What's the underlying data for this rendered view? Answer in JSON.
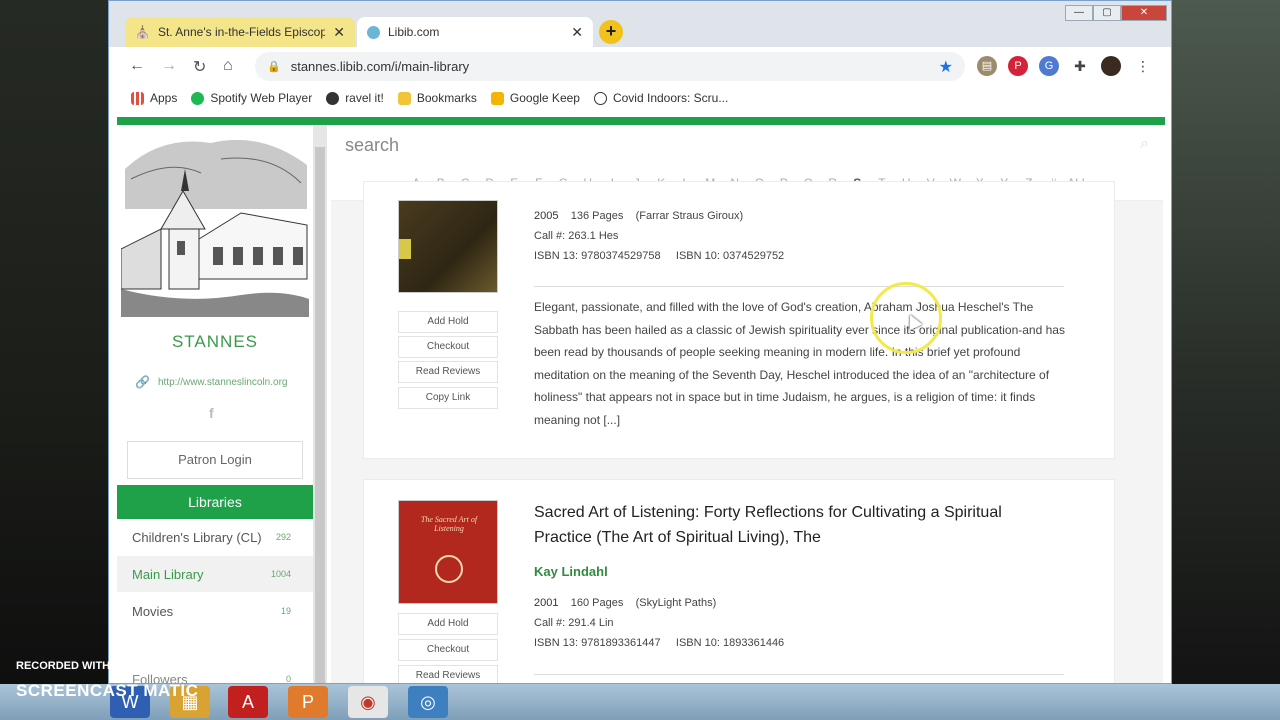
{
  "browser": {
    "tabs": [
      {
        "label": "St. Anne's in-the-Fields Episcopa",
        "close": "✕"
      },
      {
        "label": "Libib.com",
        "close": "✕"
      }
    ],
    "new_tab": "+",
    "url": "stannes.libib.com/i/main-library",
    "bookmarks": [
      "Apps",
      "Spotify Web Player",
      "ravel it!",
      "Bookmarks",
      "Google Keep",
      "Covid Indoors: Scru..."
    ]
  },
  "sidebar": {
    "library_name": "STANNES",
    "website": "http://www.stanneslincoln.org",
    "facebook": "f",
    "patron_login": "Patron Login",
    "libraries_heading": "Libraries",
    "libraries": [
      {
        "name": "Children's Library (CL)",
        "count": "292"
      },
      {
        "name": "Main Library",
        "count": "1004"
      },
      {
        "name": "Movies",
        "count": "19"
      },
      {
        "name": "Followers",
        "count": "0"
      }
    ]
  },
  "main": {
    "search_placeholder": "search",
    "alphabet": [
      "A",
      "B",
      "C",
      "D",
      "E",
      "F",
      "G",
      "H",
      "I",
      "J",
      "K",
      "L",
      "M",
      "N",
      "O",
      "P",
      "Q",
      "R",
      "S",
      "T",
      "U",
      "V",
      "W",
      "X",
      "Y",
      "Z",
      "#",
      "ALL"
    ],
    "current_letter": "S",
    "item1": {
      "year": "2005",
      "pages": "136 Pages",
      "publisher": "(Farrar Straus Giroux)",
      "call_label": "Call #:",
      "call": "263.1 Hes",
      "isbn13_label": "ISBN 13:",
      "isbn13": "9780374529758",
      "isbn10_label": "ISBN 10:",
      "isbn10": "0374529752",
      "buttons": [
        "Add Hold",
        "Checkout",
        "Read Reviews",
        "Copy Link"
      ],
      "description": "Elegant, passionate, and filled with the love of God's creation, Abraham Joshua Heschel's The Sabbath has been hailed as a classic of Jewish spirituality ever since its original publication-and has been read by thousands of people seeking meaning in modern life. In this brief yet profound meditation on the meaning of the Seventh Day, Heschel introduced the idea of an \"architecture of holiness\" that appears not in space but in time Judaism, he argues, is a religion of time: it finds meaning not [...]"
    },
    "item2": {
      "title": "Sacred Art of Listening: Forty Reflections for Cultivating a Spiritual Practice (The Art of Spiritual Living), The",
      "author": "Kay Lindahl",
      "year": "2001",
      "pages": "160 Pages",
      "publisher": "(SkyLight Paths)",
      "call_label": "Call #:",
      "call": "291.4 Lin",
      "isbn13_label": "ISBN 13:",
      "isbn13": "9781893361447",
      "isbn10_label": "ISBN 10:",
      "isbn10": "1893361446",
      "buttons": [
        "Add Hold",
        "Checkout",
        "Read Reviews"
      ],
      "cover_title": "The Sacred Art of Listening"
    }
  },
  "watermark": {
    "line1": "RECORDED WITH",
    "line2": "SCREENCAST MATIC"
  },
  "colors": {
    "accent": "#1fa14a",
    "link": "#2e8b3f"
  }
}
